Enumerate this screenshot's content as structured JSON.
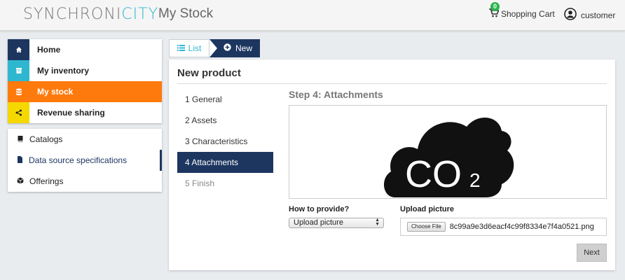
{
  "header": {
    "logo_main": "SYNCHRONI",
    "logo_accent": "CITY",
    "app_title": "My Stock",
    "cart_label": "Shopping Cart",
    "cart_count": "0",
    "user_label": "customer"
  },
  "sidebar": {
    "primary": [
      {
        "label": "Home",
        "icon": "home-icon",
        "color": "#1d3660"
      },
      {
        "label": "My inventory",
        "icon": "archive-icon",
        "color": "#30b7d0"
      },
      {
        "label": "My stock",
        "icon": "database-icon",
        "color": "#ff7a0d"
      },
      {
        "label": "Revenue sharing",
        "icon": "share-icon",
        "color": "#f5d800"
      }
    ],
    "secondary": [
      {
        "label": "Catalogs",
        "icon": "book-icon"
      },
      {
        "label": "Data source specifications",
        "icon": "file-icon"
      },
      {
        "label": "Offerings",
        "icon": "cube-icon"
      }
    ]
  },
  "tabs": {
    "list_label": "List",
    "new_label": "New"
  },
  "panel": {
    "title": "New product",
    "steps": [
      "1 General",
      "2 Assets",
      "3 Characteristics",
      "4 Attachments",
      "5 Finish"
    ],
    "step_title": "Step 4: Attachments",
    "preview_text": "CO",
    "preview_sub": "2",
    "provide_label": "How to provide?",
    "provide_value": "Upload picture",
    "upload_label": "Upload picture",
    "choose_file_label": "Choose File",
    "file_name": "8c99a9e3d6eacf4c99f8334e7f4a0521.png",
    "next_label": "Next"
  },
  "colors": {
    "navy": "#1d3660",
    "cyan": "#30b7d0",
    "orange": "#ff7a0d",
    "yellow": "#f5d800",
    "green_badge": "#2ab54e"
  }
}
